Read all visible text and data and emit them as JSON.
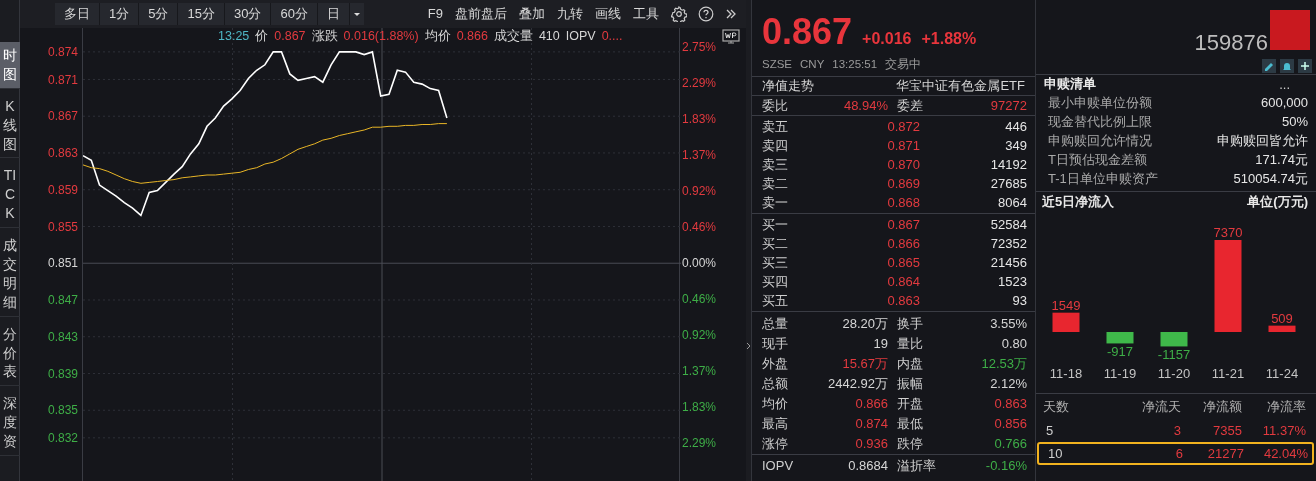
{
  "side_tabs": [
    {
      "label": "时图",
      "selected": true
    },
    {
      "label": "K线图",
      "selected": false
    },
    {
      "label": "TICK",
      "selected": false
    },
    {
      "label": "成交明细",
      "selected": false
    },
    {
      "label": "分价表",
      "selected": false
    },
    {
      "label": "深度资",
      "selected": false
    }
  ],
  "toolbar": {
    "periods": [
      "多日",
      "1分",
      "5分",
      "15分",
      "30分",
      "60分",
      "日"
    ],
    "tools": [
      "F9",
      "盘前盘后",
      "叠加",
      "九转",
      "画线",
      "工具"
    ]
  },
  "chart_info": [
    {
      "label": "13:25",
      "color": "#4eb6c4"
    },
    {
      "label": "价",
      "value": "0.867",
      "color": "#e23a3f"
    },
    {
      "label": "涨跌",
      "value": "0.016(1.88%)",
      "color": "#e23a3f"
    },
    {
      "label": "均价",
      "value": "0.866",
      "color": "#e23a3f"
    },
    {
      "label": "成交量",
      "value": "410",
      "color": "#d6d6d6"
    },
    {
      "label": "IOPV",
      "value": "0....",
      "color": "#e23a3f"
    }
  ],
  "intraday": {
    "chart_data": {
      "type": "line",
      "categories": [
        null,
        null,
        null,
        null,
        null,
        null,
        null,
        null,
        null,
        null,
        null,
        null,
        null,
        null,
        null,
        null,
        null,
        null,
        null,
        null,
        null,
        null,
        null,
        null,
        null,
        null,
        null,
        null,
        null,
        null,
        null,
        null,
        null,
        null,
        null,
        null,
        null,
        null,
        null,
        null,
        null,
        null,
        null,
        null,
        null
      ],
      "ylim": [
        0.8273,
        0.8766
      ],
      "grid": true,
      "yticks": [
        {
          "value": 0.874,
          "label": "0.874"
        },
        {
          "value": 0.871,
          "label": "0.871"
        },
        {
          "value": 0.867,
          "label": "0.867"
        },
        {
          "value": 0.863,
          "label": "0.863"
        },
        {
          "value": 0.859,
          "label": "0.859"
        },
        {
          "value": 0.855,
          "label": "0.855"
        },
        {
          "value": 0.851,
          "label": "0.851"
        },
        {
          "value": 0.847,
          "label": "0.847"
        },
        {
          "value": 0.843,
          "label": "0.843"
        },
        {
          "value": 0.839,
          "label": "0.839"
        },
        {
          "value": 0.835,
          "label": "0.835"
        },
        {
          "value": 0.832,
          "label": "0.832"
        }
      ],
      "series": [
        {
          "color": "#ffffff",
          "values": [
            0.8627,
            0.8622,
            0.8595,
            0.8589,
            0.8583,
            0.8576,
            0.857,
            0.8562,
            0.8587,
            0.8589,
            0.8598,
            0.8607,
            0.8615,
            0.8629,
            0.864,
            0.8659,
            0.8668,
            0.8681,
            0.8689,
            0.8698,
            0.8711,
            0.872,
            0.8726,
            0.874,
            0.874,
            0.8716,
            0.8709,
            0.8711,
            0.8713,
            0.8707,
            0.8726,
            0.874,
            0.874,
            0.874,
            0.8737,
            0.874,
            0.8692,
            0.8694,
            0.872,
            0.8718,
            0.8707,
            0.8705,
            0.87,
            0.8698,
            0.8668
          ]
        },
        {
          "color": "#e8b526",
          "values": [
            0.8617,
            0.8614,
            0.8613,
            0.861,
            0.8606,
            0.8602,
            0.8599,
            0.8597,
            0.8598,
            0.8599,
            0.86,
            0.8601,
            0.8603,
            0.8604,
            0.8605,
            0.8606,
            0.8606,
            0.8607,
            0.8608,
            0.8609,
            0.8612,
            0.8614,
            0.8618,
            0.862,
            0.8624,
            0.8629,
            0.8634,
            0.8637,
            0.864,
            0.8644,
            0.8646,
            0.8649,
            0.8651,
            0.8653,
            0.8655,
            0.8658,
            0.8658,
            0.8659,
            0.8659,
            0.866,
            0.866,
            0.8661,
            0.8661,
            0.8662,
            0.8662
          ]
        }
      ]
    }
  },
  "percent_axis": [
    {
      "label": "2.75%",
      "color": "#e23a3f"
    },
    {
      "label": "2.29%",
      "color": "#e23a3f"
    },
    {
      "label": "1.83%",
      "color": "#e23a3f"
    },
    {
      "label": "1.37%",
      "color": "#e23a3f"
    },
    {
      "label": "0.92%",
      "color": "#e23a3f"
    },
    {
      "label": "0.46%",
      "color": "#e23a3f"
    },
    {
      "label": "0.00%",
      "color": "#d6d6d6"
    },
    {
      "label": "0.46%",
      "color": "#3eae47"
    },
    {
      "label": "0.92%",
      "color": "#3eae47"
    },
    {
      "label": "1.37%",
      "color": "#3eae47"
    },
    {
      "label": "1.83%",
      "color": "#3eae47"
    },
    {
      "label": "2.29%",
      "color": "#3eae47"
    }
  ],
  "quote": {
    "price": "0.867",
    "change": "+0.016",
    "change_pct": "+1.88%",
    "exchange": "SZSE",
    "currency": "CNY",
    "time": "13:25:51",
    "status": "交易中"
  },
  "nav": {
    "label": "净值走势",
    "fund_name": "华宝中证有色金属ETF"
  },
  "ratio": [
    {
      "label": "委比",
      "value": "48.94%",
      "color": "#e23a3f"
    },
    {
      "label": "委差",
      "value": "97272",
      "color": "#e23a3f"
    }
  ],
  "asks": [
    {
      "label": "卖五",
      "price": "0.872",
      "volume": "446"
    },
    {
      "label": "卖四",
      "price": "0.871",
      "volume": "349"
    },
    {
      "label": "卖三",
      "price": "0.870",
      "volume": "14192"
    },
    {
      "label": "卖二",
      "price": "0.869",
      "volume": "27685"
    },
    {
      "label": "卖一",
      "price": "0.868",
      "volume": "8064"
    }
  ],
  "bids": [
    {
      "label": "买一",
      "price": "0.867",
      "volume": "52584"
    },
    {
      "label": "买二",
      "price": "0.866",
      "volume": "72352"
    },
    {
      "label": "买三",
      "price": "0.865",
      "volume": "21456"
    },
    {
      "label": "买四",
      "price": "0.864",
      "volume": "1523"
    },
    {
      "label": "买五",
      "price": "0.863",
      "volume": "93"
    }
  ],
  "stats": [
    [
      {
        "label": "总量",
        "value": "28.20万",
        "color": "#d6d6d6"
      },
      {
        "label": "换手",
        "value": "3.55%",
        "color": "#d6d6d6"
      }
    ],
    [
      {
        "label": "现手",
        "value": "19",
        "color": "#d6d6d6"
      },
      {
        "label": "量比",
        "value": "0.80",
        "color": "#d6d6d6"
      }
    ],
    [
      {
        "label": "外盘",
        "value": "15.67万",
        "color": "#e23a3f"
      },
      {
        "label": "内盘",
        "value": "12.53万",
        "color": "#3eae47"
      }
    ],
    [
      {
        "label": "总额",
        "value": "2442.92万",
        "color": "#d6d6d6"
      },
      {
        "label": "振幅",
        "value": "2.12%",
        "color": "#d6d6d6"
      }
    ],
    [
      {
        "label": "均价",
        "value": "0.866",
        "color": "#e23a3f"
      },
      {
        "label": "开盘",
        "value": "0.863",
        "color": "#e23a3f"
      }
    ],
    [
      {
        "label": "最高",
        "value": "0.874",
        "color": "#e23a3f"
      },
      {
        "label": "最低",
        "value": "0.856",
        "color": "#e23a3f"
      }
    ],
    [
      {
        "label": "涨停",
        "value": "0.936",
        "color": "#e23a3f"
      },
      {
        "label": "跌停",
        "value": "0.766",
        "color": "#3eae47"
      }
    ],
    [
      {
        "label": "IOPV",
        "value": "0.8684",
        "color": "#d6d6d6"
      },
      {
        "label": "溢折率",
        "value": "-0.16%",
        "color": "#3eae47"
      }
    ]
  ],
  "code": "159876",
  "creation_list": {
    "title": "申赎清单",
    "more": "...",
    "items": [
      {
        "label": "最小申赎单位份额",
        "value": "600,000"
      },
      {
        "label": "现金替代比例上限",
        "value": "50%"
      },
      {
        "label": "申购赎回允许情况",
        "value": "申购赎回皆允许"
      },
      {
        "label": "T日预估现金差额",
        "value": "171.74元"
      },
      {
        "label": "T-1日单位申赎资产",
        "value": "510054.74元"
      }
    ]
  },
  "net_inflow": {
    "title": "近5日净流入",
    "unit": "单位(万元)",
    "chart_data": {
      "type": "bar",
      "categories": [
        "11-18",
        "11-19",
        "11-20",
        "11-21",
        "11-24"
      ],
      "values": [
        1549,
        -917,
        -1157,
        7370,
        509
      ],
      "data_labels": true
    }
  },
  "flow_table": {
    "columns": [
      "天数",
      "净流天",
      "净流额",
      "净流率"
    ],
    "rows": [
      {
        "cells": [
          "5",
          "3",
          "7355",
          "11.37%"
        ],
        "highlighted": false
      },
      {
        "cells": [
          "10",
          "6",
          "21277",
          "42.04%"
        ],
        "highlighted": true
      }
    ]
  }
}
